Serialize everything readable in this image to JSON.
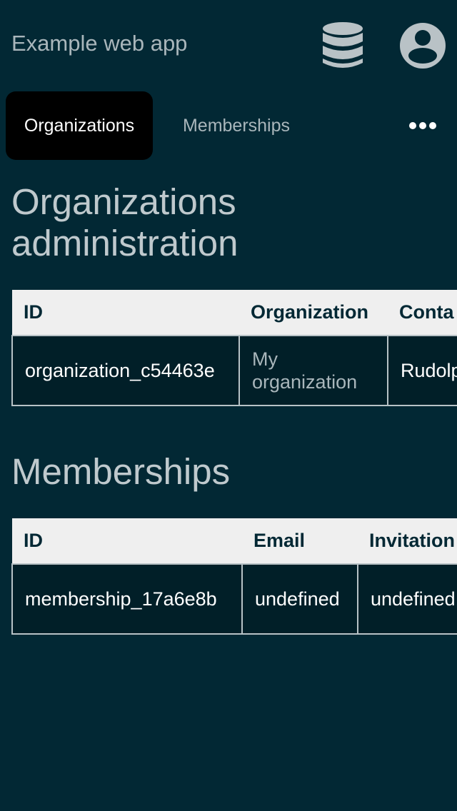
{
  "header": {
    "title": "Example web app",
    "database_icon": "database-icon",
    "account_icon": "user-circle-icon"
  },
  "tabs": [
    {
      "label": "Organizations",
      "active": true
    },
    {
      "label": "Memberships",
      "active": false
    }
  ],
  "more_icon": "more-horizontal-icon",
  "organizations": {
    "heading": "Organizations administration",
    "columns": [
      "ID",
      "Organization",
      "Conta"
    ],
    "rows": [
      {
        "id": "organization_c54463e",
        "organization": "My organization",
        "contact": "Rudolp"
      }
    ]
  },
  "memberships": {
    "heading": "Memberships",
    "columns": [
      "ID",
      "Email",
      "Invitation"
    ],
    "rows": [
      {
        "id": "membership_17a6e8b",
        "email": "undefined",
        "invitation": "undefined"
      }
    ]
  },
  "colors": {
    "background": "#022834",
    "active_tab": "#000000",
    "header_row": "#efefef",
    "cell_background": "#011f28",
    "muted_text": "#a9b6bb"
  }
}
